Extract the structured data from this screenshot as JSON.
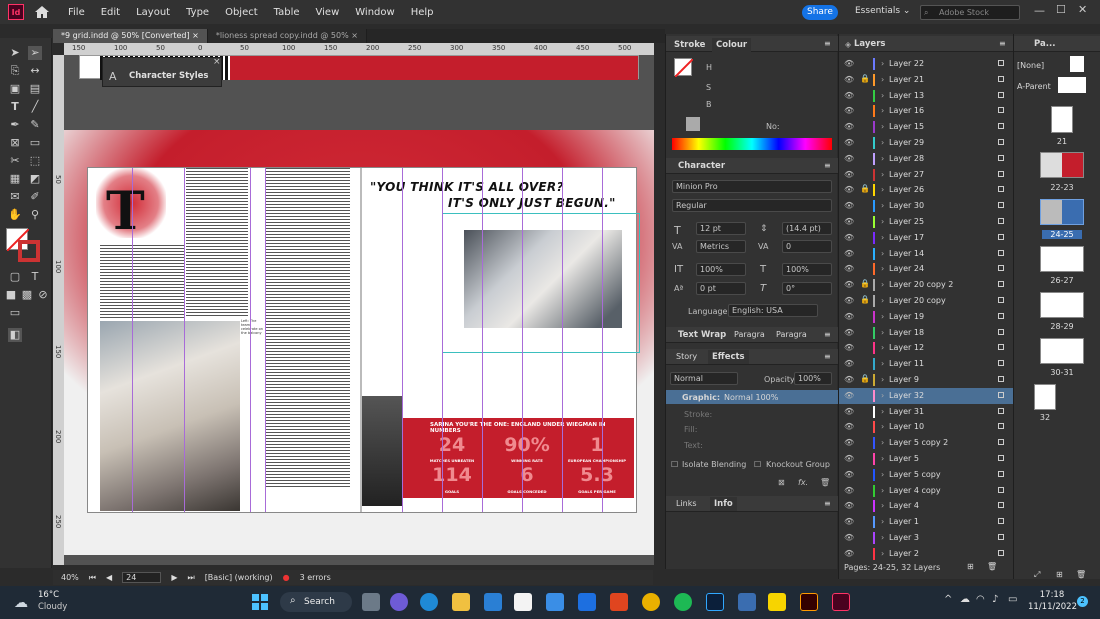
{
  "menubar": {
    "app_badge": "Id",
    "items": [
      "File",
      "Edit",
      "Layout",
      "Type",
      "Object",
      "Table",
      "View",
      "Window",
      "Help"
    ],
    "share_label": "Share",
    "workspace": "Essentials",
    "stock_placeholder": "Adobe Stock"
  },
  "tabs": [
    {
      "label": "*9 grid.indd @ 50% [Converted]",
      "close": "×"
    },
    {
      "label": "*lioness spread copy.indd @ 50%",
      "close": "×"
    }
  ],
  "ruler": {
    "h_marks": [
      "150",
      "100",
      "50",
      "0",
      "50",
      "100",
      "150",
      "200",
      "250",
      "300",
      "350",
      "400",
      "450",
      "500"
    ],
    "v_marks": [
      "50",
      "100",
      "150",
      "200",
      "250"
    ]
  },
  "floating_panel": {
    "title": "Character Styles"
  },
  "spread": {
    "headline_line1": "\"YOU THINK IT'S ALL OVER?",
    "headline_line2": "IT'S ONLY JUST BEGUN.\"",
    "drop_cap": "T",
    "caption": "Left: The team celebrate on the balcony",
    "banner": "SARINA YOU'RE THE ONE: ENGLAND UNDER WIEGMAN IN NUMBERS",
    "stats": [
      {
        "value": "24",
        "label": "MATCHES UNBEATEN"
      },
      {
        "value": "90%",
        "label": "WINNING RATE"
      },
      {
        "value": "1",
        "label": "EUROPEAN CHAMPIONSHIP"
      },
      {
        "value": "114",
        "label": "GOALS"
      },
      {
        "value": "6",
        "label": "GOALS CONCEDED"
      },
      {
        "value": "5.3",
        "label": "GOALS PER GAME"
      }
    ]
  },
  "statusbar": {
    "zoom": "40%",
    "page": "24",
    "style": "[Basic] (working)",
    "errors": "3 errors"
  },
  "stroke_panel": {
    "tab_stroke": "Stroke",
    "tab_colour": "Colour",
    "h": "H",
    "s": "S",
    "b": "B",
    "no": "No:"
  },
  "character": {
    "title": "Character",
    "font": "Minion Pro",
    "style": "Regular",
    "size": "12 pt",
    "leading": "(14.4 pt)",
    "kerning": "Metrics",
    "tracking": "0",
    "vscale": "100%",
    "hscale": "100%",
    "baseline": "0 pt",
    "skew": "0°",
    "language_label": "Language:",
    "language": "English: USA"
  },
  "textwrap": {
    "tabs": [
      "Text Wrap",
      "Paragra",
      "Paragra"
    ]
  },
  "effects": {
    "tabs": [
      "Story",
      "Effects"
    ],
    "blend": "Normal",
    "opacity_label": "Opacity:",
    "opacity": "100%",
    "graphic": "Graphic:",
    "graphic_val": "Normal 100%",
    "stroke": "Stroke:",
    "fill": "Fill:",
    "text": "Text:",
    "isolate": "Isolate Blending",
    "knockout": "Knockout Group"
  },
  "links": {
    "tabs": [
      "Links",
      "Info"
    ]
  },
  "layers": {
    "title": "Layers",
    "items": [
      {
        "name": "Layer 22",
        "color": "#6b7aff",
        "lock": false
      },
      {
        "name": "Layer 21",
        "color": "#ff9a2a",
        "lock": true
      },
      {
        "name": "Layer 13",
        "color": "#33cc44",
        "lock": false
      },
      {
        "name": "Layer 16",
        "color": "#ff7a1a",
        "lock": false
      },
      {
        "name": "Layer 15",
        "color": "#9a3acc",
        "lock": false
      },
      {
        "name": "Layer 29",
        "color": "#33cccc",
        "lock": false
      },
      {
        "name": "Layer 28",
        "color": "#bfa0ff",
        "lock": false
      },
      {
        "name": "Layer 27",
        "color": "#cc3333",
        "lock": false
      },
      {
        "name": "Layer 26",
        "color": "#ffd600",
        "lock": true
      },
      {
        "name": "Layer 30",
        "color": "#2a9aff",
        "lock": false
      },
      {
        "name": "Layer 25",
        "color": "#9aff33",
        "lock": false
      },
      {
        "name": "Layer 17",
        "color": "#7a2aff",
        "lock": false
      },
      {
        "name": "Layer 14",
        "color": "#2ab0ff",
        "lock": false
      },
      {
        "name": "Layer 24",
        "color": "#ff6a2a",
        "lock": false
      },
      {
        "name": "Layer 20 copy 2",
        "color": "#aaaaaa",
        "lock": true
      },
      {
        "name": "Layer 20 copy",
        "color": "#aaaaaa",
        "lock": true
      },
      {
        "name": "Layer 19",
        "color": "#cc33cc",
        "lock": false
      },
      {
        "name": "Layer 18",
        "color": "#33cc66",
        "lock": false
      },
      {
        "name": "Layer 12",
        "color": "#ff3388",
        "lock": false
      },
      {
        "name": "Layer 11",
        "color": "#33aacc",
        "lock": false
      },
      {
        "name": "Layer 9",
        "color": "#ccaa33",
        "lock": true
      },
      {
        "name": "Layer 32",
        "color": "#ff8acc",
        "lock": false,
        "sel": true
      },
      {
        "name": "Layer 31",
        "color": "#ffffff",
        "lock": false
      },
      {
        "name": "Layer 10",
        "color": "#ff4a4a",
        "lock": false
      },
      {
        "name": "Layer 5 copy 2",
        "color": "#3355ff",
        "lock": false
      },
      {
        "name": "Layer 5",
        "color": "#ff44aa",
        "lock": false
      },
      {
        "name": "Layer 5 copy",
        "color": "#2255ff",
        "lock": false
      },
      {
        "name": "Layer 4 copy",
        "color": "#33cc33",
        "lock": false
      },
      {
        "name": "Layer 4",
        "color": "#cc33ff",
        "lock": false
      },
      {
        "name": "Layer 1",
        "color": "#5599ff",
        "lock": false
      },
      {
        "name": "Layer 3",
        "color": "#aa44ff",
        "lock": false
      },
      {
        "name": "Layer 2",
        "color": "#ff3344",
        "lock": false
      }
    ],
    "footer": "Pages: 24-25, 32 Layers"
  },
  "pages": {
    "title": "Pa...",
    "none": "[None]",
    "parent": "A-Parent",
    "labels": [
      "21",
      "22-23",
      "24-25",
      "26-27",
      "28-29",
      "30-31",
      "32"
    ]
  },
  "taskbar": {
    "weather_temp": "16°C",
    "weather_desc": "Cloudy",
    "search": "Search",
    "time": "17:18",
    "date": "11/11/2022",
    "badge": "2"
  }
}
